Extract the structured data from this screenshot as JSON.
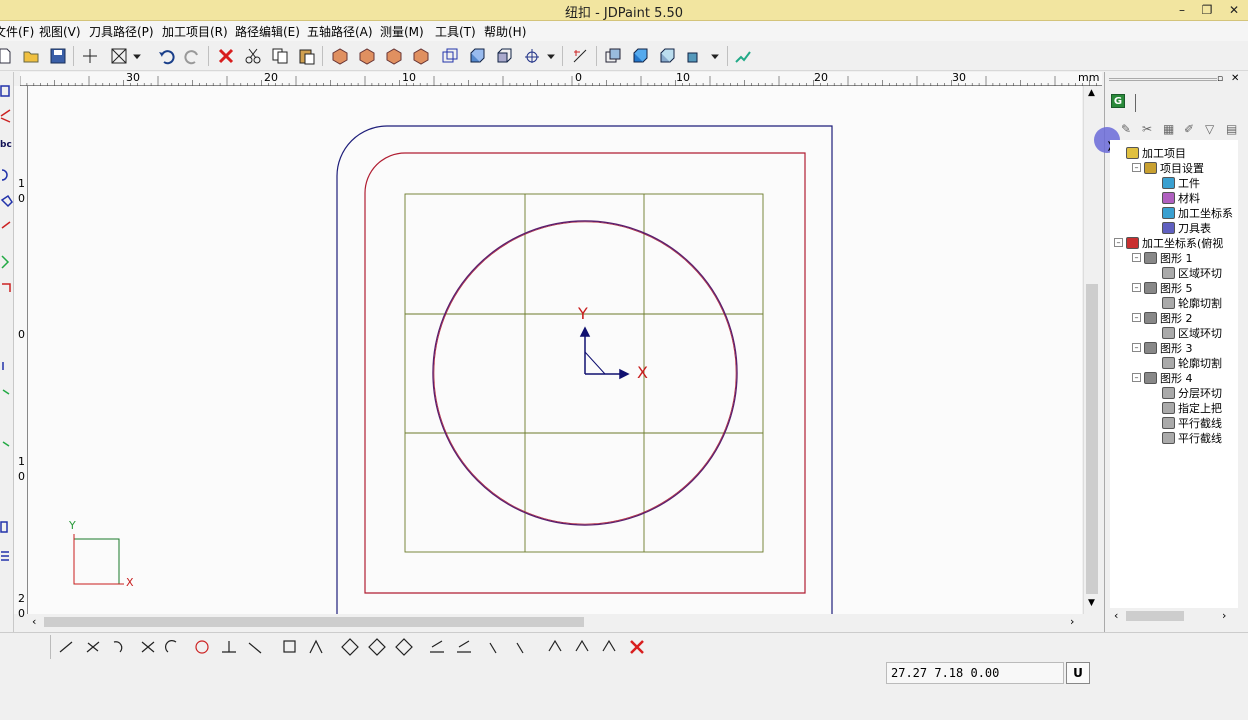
{
  "window": {
    "title": "纽扣 - JDPaint 5.50",
    "minimize": "–",
    "restore": "❐",
    "close": "✕"
  },
  "menu": [
    "文件(F)",
    "视图(V)",
    "刀具路径(P)",
    "加工项目(R)",
    "路径编辑(E)",
    "五轴路径(A)",
    "测量(M)",
    "工具(T)",
    "帮助(H)"
  ],
  "ruler": {
    "labels": [
      "30",
      "20",
      "10",
      "0",
      "10",
      "20",
      "30"
    ],
    "unit": "mm",
    "vlabels": [
      "1 0",
      "0",
      "1 0",
      "2 0"
    ]
  },
  "canvas": {
    "y_label": "Y",
    "x_label": "X",
    "mini_y_label": "Y",
    "mini_x_label": "X"
  },
  "panel": {
    "tab_label": "G",
    "tree": [
      {
        "label": "加工项目",
        "depth": 0,
        "expander": "",
        "icon": "folder-icon"
      },
      {
        "label": "项目设置",
        "depth": 1,
        "expander": "–",
        "icon": "settings-icon"
      },
      {
        "label": "工件",
        "depth": 2,
        "expander": "",
        "icon": "workpiece-icon"
      },
      {
        "label": "材料",
        "depth": 2,
        "expander": "",
        "icon": "material-icon"
      },
      {
        "label": "加工坐标系",
        "depth": 2,
        "expander": "",
        "icon": "coordinate-icon"
      },
      {
        "label": "刀具表",
        "depth": 2,
        "expander": "",
        "icon": "tool-icon"
      },
      {
        "label": "加工坐标系(俯视",
        "depth": 0,
        "expander": "–",
        "icon": "axes-icon"
      },
      {
        "label": "图形 1",
        "depth": 1,
        "expander": "–",
        "icon": "shape-icon"
      },
      {
        "label": "区域环切",
        "depth": 2,
        "expander": "",
        "icon": "path-icon"
      },
      {
        "label": "图形 5",
        "depth": 1,
        "expander": "–",
        "icon": "shape-icon"
      },
      {
        "label": "轮廓切割",
        "depth": 2,
        "expander": "",
        "icon": "path-icon"
      },
      {
        "label": "图形 2",
        "depth": 1,
        "expander": "–",
        "icon": "shape-icon"
      },
      {
        "label": "区域环切",
        "depth": 2,
        "expander": "",
        "icon": "path-icon"
      },
      {
        "label": "图形 3",
        "depth": 1,
        "expander": "–",
        "icon": "shape-icon"
      },
      {
        "label": "轮廓切割",
        "depth": 2,
        "expander": "",
        "icon": "path-icon"
      },
      {
        "label": "图形 4",
        "depth": 1,
        "expander": "–",
        "icon": "shape-icon"
      },
      {
        "label": "分层环切",
        "depth": 2,
        "expander": "",
        "icon": "path-icon"
      },
      {
        "label": "指定上把",
        "depth": 2,
        "expander": "",
        "icon": "path-icon"
      },
      {
        "label": "平行截线",
        "depth": 2,
        "expander": "",
        "icon": "path-icon"
      },
      {
        "label": "平行截线",
        "depth": 2,
        "expander": "",
        "icon": "path-icon"
      }
    ]
  },
  "status": {
    "coordinates": "27.27 7.18 0.00",
    "unit_button": "U"
  },
  "colors": {
    "titlebar": "#f2e5a0",
    "outer_boundary": "#1e1e7a",
    "inner_boundary": "#b01e32",
    "grid": "#6b7a2a",
    "circle": "#5a1f6e",
    "axis_arrow": "#101070",
    "axis_label": "#c81e1e"
  }
}
